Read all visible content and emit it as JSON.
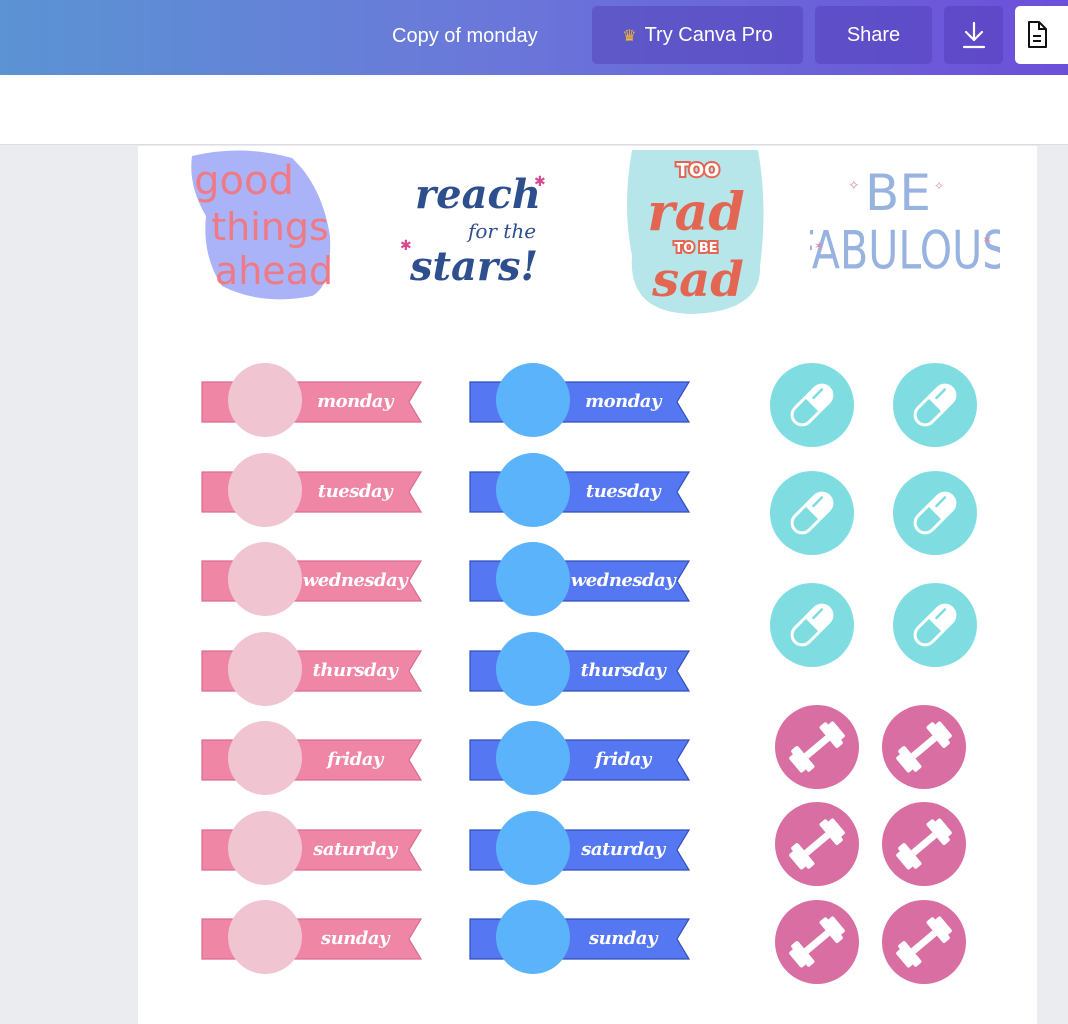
{
  "topbar": {
    "document_title": "Copy of monday",
    "try_pro_label": "Try Canva Pro",
    "share_label": "Share",
    "download_icon": "download-icon",
    "notes_icon": "document-icon",
    "crown_icon": "crown-icon"
  },
  "stickers": [
    {
      "name": "good-things-ahead",
      "lines": [
        "good",
        "things",
        "ahead"
      ]
    },
    {
      "name": "reach-for-the-stars",
      "lines": [
        "reach",
        "for the",
        "stars!"
      ]
    },
    {
      "name": "too-rad-to-be-sad",
      "lines": [
        "TOO",
        "rad",
        "TO BE",
        "sad"
      ]
    },
    {
      "name": "be-fabulous",
      "lines": [
        "BE",
        "FABULOUS"
      ]
    }
  ],
  "ribbons": {
    "pink": {
      "color": "#ef86a5",
      "circle_color": "#f0c4d1",
      "days": [
        "monday",
        "tuesday",
        "wednesday",
        "thursday",
        "friday",
        "saturday",
        "sunday"
      ]
    },
    "blue": {
      "color": "#5577f2",
      "circle_color": "#5bb3fb",
      "days": [
        "monday",
        "tuesday",
        "wednesday",
        "thursday",
        "friday",
        "saturday",
        "sunday"
      ]
    }
  },
  "icons": {
    "pill": {
      "color": "#7fdde2",
      "count": 6,
      "icon": "pill-icon"
    },
    "dumbbell": {
      "color": "#d86ea2",
      "count": 6,
      "icon": "dumbbell-icon"
    }
  }
}
